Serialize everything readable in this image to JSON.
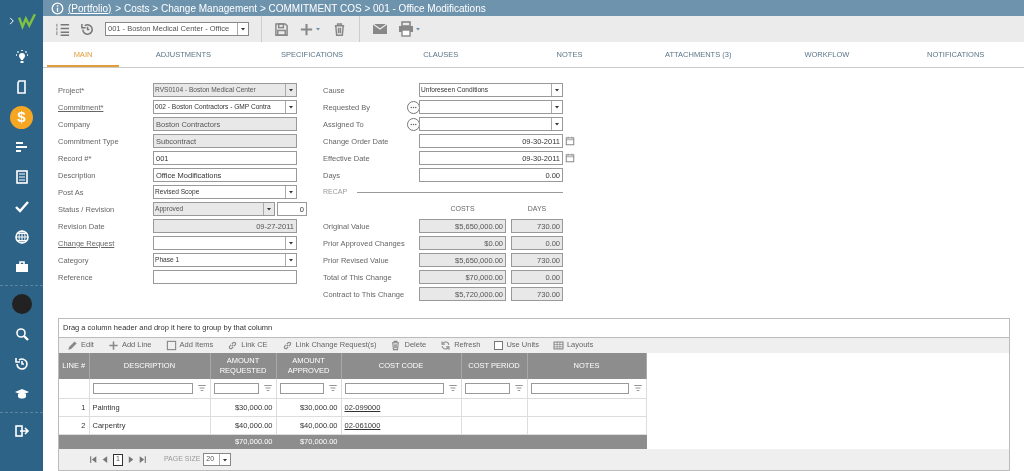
{
  "sidebar": {
    "items": [
      {
        "kind": "bulb",
        "selected": false
      },
      {
        "kind": "document",
        "selected": false
      },
      {
        "kind": "dollar",
        "label": "$",
        "selected": true
      },
      {
        "kind": "bars",
        "selected": false
      },
      {
        "kind": "building",
        "selected": false
      },
      {
        "kind": "check",
        "selected": false
      },
      {
        "kind": "globe",
        "selected": false
      },
      {
        "kind": "briefcase",
        "selected": false
      },
      {
        "kind": "avatar",
        "selected": false
      },
      {
        "kind": "search",
        "selected": false
      },
      {
        "kind": "history",
        "selected": false
      },
      {
        "kind": "cap",
        "selected": false
      },
      {
        "kind": "signout",
        "selected": false
      }
    ]
  },
  "breadcrumb": {
    "parts": [
      {
        "text": "(Portfolio)",
        "link": true
      },
      {
        "text": "> Costs > Change Management > COMMITMENT COS > 001 - Office Modifications",
        "link": false
      }
    ]
  },
  "toolbar": {
    "record_select": "001 - Boston Medical Center - Office"
  },
  "tabs": [
    {
      "label": "MAIN",
      "selected": true
    },
    {
      "label": "ADJUSTMENTS",
      "selected": false
    },
    {
      "label": "SPECIFICATIONS",
      "selected": false
    },
    {
      "label": "CLAUSES",
      "selected": false
    },
    {
      "label": "NOTES",
      "selected": false
    },
    {
      "label": "ATTACHMENTS (3)",
      "selected": false
    },
    {
      "label": "WORKFLOW",
      "selected": false
    },
    {
      "label": "NOTIFICATIONS",
      "selected": false
    }
  ],
  "left_fields": [
    {
      "label": "Project*",
      "link": false,
      "kind": "select",
      "value": "RVS0104 - Boston Medical Center",
      "disabled": true
    },
    {
      "label": "Commitment*",
      "link": true,
      "kind": "select",
      "value": "002 - Boston Contractors - GMP Contra",
      "disabled": false
    },
    {
      "label": "Company",
      "link": false,
      "kind": "text",
      "value": "Boston Contractors",
      "disabled": true
    },
    {
      "label": "Commitment Type",
      "link": false,
      "kind": "text",
      "value": "Subcontract",
      "disabled": true
    },
    {
      "label": "Record #*",
      "link": false,
      "kind": "text",
      "value": "001",
      "disabled": false
    },
    {
      "label": "Description",
      "link": false,
      "kind": "text",
      "value": "Office Modifications",
      "disabled": false
    },
    {
      "label": "Post As",
      "link": false,
      "kind": "select",
      "value": "Revised Scope",
      "disabled": false
    },
    {
      "label": "Status / Revision",
      "link": false,
      "kind": "status",
      "value": "Approved",
      "revision": "0",
      "disabled": true
    },
    {
      "label": "Revision Date",
      "link": false,
      "kind": "date",
      "value": "09-27-2011",
      "disabled": true
    },
    {
      "label": "Change Request",
      "link": true,
      "kind": "select",
      "disabled": false
    },
    {
      "label": "Category",
      "link": false,
      "kind": "select",
      "value": "Phase 1",
      "disabled": false
    },
    {
      "label": "Reference",
      "link": false,
      "kind": "text",
      "disabled": false
    }
  ],
  "right_fields": [
    {
      "label": "Cause",
      "kind": "select",
      "value": "Unforeseen Conditions"
    },
    {
      "label": "Requested By",
      "kind": "person"
    },
    {
      "label": "Assigned To",
      "kind": "person"
    },
    {
      "label": "Change Order Date",
      "kind": "date",
      "value": "09-30-2011"
    },
    {
      "label": "Effective Date",
      "kind": "date",
      "value": "09-30-2011"
    },
    {
      "label": "Days",
      "kind": "number",
      "value": "0.00"
    }
  ],
  "recap": {
    "title": "RECAP",
    "columns": [
      "COSTS",
      "DAYS"
    ],
    "rows": [
      {
        "label": "Original Value",
        "costs": "$5,650,000.00",
        "days": "730.00"
      },
      {
        "label": "Prior Approved Changes",
        "costs": "$0.00",
        "days": "0.00"
      },
      {
        "label": "Prior Revised Value",
        "costs": "$5,650,000.00",
        "days": "730.00"
      },
      {
        "label": "Total of This Change",
        "costs": "$70,000.00",
        "days": "0.00"
      },
      {
        "label": "Contract to This Change",
        "costs": "$5,720,000.00",
        "days": "730.00"
      }
    ]
  },
  "grid": {
    "group_hint": "Drag a column header and drop it here to group by that column",
    "actions": [
      {
        "kind": "pencil",
        "label": "Edit"
      },
      {
        "kind": "plus",
        "label": "Add Line"
      },
      {
        "kind": "square",
        "label": "Add Items"
      },
      {
        "kind": "link",
        "label": "Link CE"
      },
      {
        "kind": "link",
        "label": "Link Change Request(s)"
      },
      {
        "kind": "trash",
        "label": "Delete"
      },
      {
        "kind": "refresh",
        "label": "Refresh"
      },
      {
        "kind": "checkbox",
        "label": "Use Units",
        "checked": false
      },
      {
        "kind": "table",
        "label": "Layouts"
      }
    ],
    "columns": [
      {
        "label": "LINE #",
        "filter": false
      },
      {
        "label": "DESCRIPTION",
        "filter": true
      },
      {
        "label": "AMOUNT REQUESTED",
        "filter": true
      },
      {
        "label": "AMOUNT APPROVED",
        "filter": true
      },
      {
        "label": "COST CODE",
        "filter": true
      },
      {
        "label": "COST PERIOD",
        "filter": true
      },
      {
        "label": "NOTES",
        "filter": true
      }
    ],
    "rows": [
      {
        "line": "1",
        "description": "Painting",
        "requested": "$30,000.00",
        "approved": "$30,000.00",
        "cost_code": "02-099000"
      },
      {
        "line": "2",
        "description": "Carpentry",
        "requested": "$40,000.00",
        "approved": "$40,000.00",
        "cost_code": "02-061000"
      }
    ],
    "totals": {
      "requested": "$70,000.00",
      "approved": "$70,000.00"
    },
    "pager": {
      "page": "1",
      "page_size_label": "PAGE SIZE",
      "page_size": "20"
    }
  }
}
